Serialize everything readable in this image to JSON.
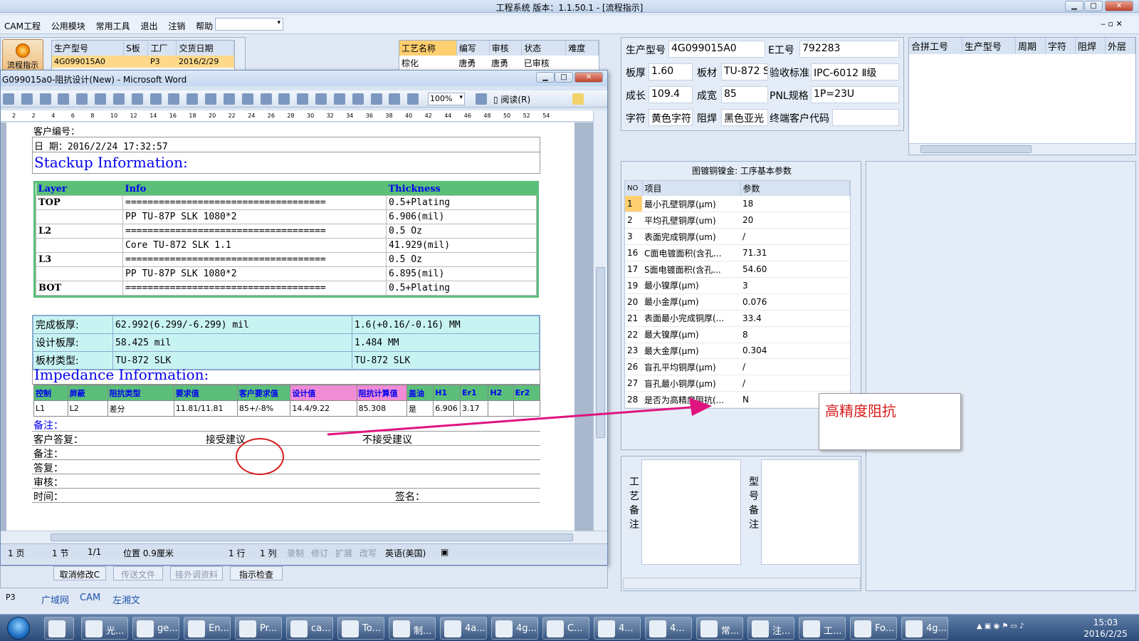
{
  "main_window": {
    "title": "工程系统   版本：1.1.50.1 - [流程指示]"
  },
  "menu": {
    "items": [
      "CAM工程",
      "公用模块",
      "常用工具",
      "退出",
      "注销",
      "帮助"
    ]
  },
  "flow_button": {
    "label": "流程指示"
  },
  "product_table": {
    "headers": [
      "生产型号",
      "S板",
      "工厂",
      "交货日期"
    ],
    "row": [
      "4G099015A0",
      "",
      "P3",
      "2016/2/29"
    ]
  },
  "process_table": {
    "headers": [
      "工艺名称",
      "编写",
      "审核",
      "状态",
      "难度"
    ],
    "row": [
      "棕化",
      "唐勇",
      "唐勇",
      "已审核",
      ""
    ]
  },
  "word": {
    "title": "G099015a0-阻抗设计(New) - Microsoft Word",
    "zoom": "100%",
    "read_button": "阅读(R)",
    "ruler_ticks": [
      "2",
      "2",
      "4",
      "6",
      "8",
      "10",
      "12",
      "14",
      "16",
      "18",
      "20",
      "22",
      "24",
      "26",
      "28",
      "30",
      "32",
      "34",
      "36",
      "38",
      "40",
      "42",
      "44",
      "46",
      "48",
      "50",
      "52",
      "54"
    ],
    "status": {
      "page": "1 页",
      "section": "1 节",
      "pages": "1/1",
      "position": "位置 0.9厘米",
      "line": "1 行",
      "col": "1 列",
      "rec": "录制",
      "trk": "修订",
      "ext": "扩展",
      "ovr": "改写",
      "lang": "英语(美国)"
    }
  },
  "doc": {
    "customer_no": "客户编号：",
    "date_line": "日    期：2016/2/24 17:32:57",
    "stackup_title": "Stackup Information:",
    "stackup_headers": [
      "Layer",
      "Info",
      "Thickness"
    ],
    "stackup_rows": [
      [
        "TOP",
        "====================================",
        "0.5+Plating"
      ],
      [
        "",
        "PP      TU-87P SLK     1080*2",
        "6.906(mil)"
      ],
      [
        "L2",
        "====================================",
        "0.5 Oz"
      ],
      [
        "",
        "Core      TU-872 SLK      1.1",
        "41.929(mil)"
      ],
      [
        "L3",
        "====================================",
        "0.5 Oz"
      ],
      [
        "",
        "PP      TU-87P SLK     1080*2",
        "6.895(mil)"
      ],
      [
        "BOT",
        "====================================",
        "0.5+Plating"
      ]
    ],
    "summary_rows": [
      [
        "完成板厚:",
        "62.992(6.299/-6.299) mil",
        "1.6(+0.16/-0.16) MM"
      ],
      [
        "设计板厚:",
        "58.425 mil",
        "1.484 MM"
      ],
      [
        "板材类型:",
        "TU-872 SLK",
        "TU-872 SLK"
      ]
    ],
    "impedance_title": "Impedance Information:",
    "impedance_headers": [
      "控制",
      "屏蔽",
      "阻抗类型",
      "要求值",
      "客户要求值",
      "设计值",
      "阻抗计算值",
      "盖油",
      "H1",
      "Er1",
      "H2",
      "Er2"
    ],
    "impedance_row": [
      "L1",
      "L2",
      "差分",
      "11.81/11.81",
      "85+/-8%",
      "14.4/9.22",
      "85.308",
      "是",
      "6.906",
      "3.17",
      "",
      ""
    ],
    "remark": "备注：",
    "customer_reply": "客户答复：",
    "accept": "接受建议",
    "reject": "不接受建议",
    "remark2": "备注：",
    "reply": "答复：",
    "review": "审核：",
    "time": "时间：",
    "sign": "签名："
  },
  "left_buttons": [
    "取消修改C",
    "传送文件",
    "接外调资料",
    "指示检查"
  ],
  "bottom_tabs": [
    "P3",
    "广域网",
    "CAM",
    "左湘文"
  ],
  "info": {
    "prod_model_label": "生产型号",
    "prod_model": "4G099015A0",
    "e_label": "E工号",
    "e_no": "792283",
    "thick_label": "板厚",
    "thick": "1.60",
    "material_label": "板材",
    "material": "TU-872 S",
    "standard_label": "验收标准",
    "standard": "IPC-6012 Ⅱ级",
    "len_label": "成长",
    "len": "109.4",
    "width_label": "成宽",
    "width": "85",
    "pnl_label": "PNL规格",
    "pnl": "1P=23U",
    "char_label": "字符",
    "char": "黄色字符",
    "mask_label": "阻焊",
    "mask": "黑色亚光",
    "end_label": "终端客户代码",
    "end": ""
  },
  "merge_headers": [
    "合拼工号",
    "生产型号",
    "周期",
    "字符",
    "阻焊",
    "外层"
  ],
  "params": {
    "title": "图镀铜镍金: 工序基本参数",
    "headers": [
      "NO",
      "项目",
      "参数"
    ],
    "rows": [
      [
        "1",
        "最小孔壁铜厚(μm)",
        "18"
      ],
      [
        "2",
        "平均孔壁铜厚(um)",
        "20"
      ],
      [
        "3",
        "表面完成铜厚(um)",
        "/"
      ],
      [
        "16",
        "C面电镀面积(含孔...",
        "71.31"
      ],
      [
        "17",
        "S面电镀面积(含孔...",
        "54.60"
      ],
      [
        "19",
        "最小镍厚(μm)",
        "3"
      ],
      [
        "20",
        "最小金厚(μm)",
        "0.076"
      ],
      [
        "21",
        "表面最小完成铜厚(...",
        "33.4"
      ],
      [
        "22",
        "最大镍厚(μm)",
        "8"
      ],
      [
        "23",
        "最大金厚(μm)",
        "0.304"
      ],
      [
        "26",
        "盲孔平均铜厚(μm)",
        "/"
      ],
      [
        "27",
        "盲孔最小铜厚(μm)",
        "/"
      ],
      [
        "28",
        "是否为高精度阻抗(...",
        "N"
      ]
    ]
  },
  "callout": "高精度阻抗",
  "memo": {
    "process_label": "工艺备注",
    "model_label": "型号备注"
  },
  "taskbar": {
    "tasks": [
      "光...",
      "ge...",
      "En...",
      "Pr...",
      "ca...",
      "To...",
      "制...",
      "4a...",
      "4g...",
      "C...",
      "4...",
      "4...",
      "常...",
      "注...",
      "工...",
      "Fo...",
      "4g..."
    ],
    "time": "15:03",
    "date": "2016/2/25"
  },
  "colors": {
    "accent": "#5bbf7a",
    "highlight": "#ffcf70",
    "annotation": "#e0147f",
    "circle": "#d81b1b"
  }
}
